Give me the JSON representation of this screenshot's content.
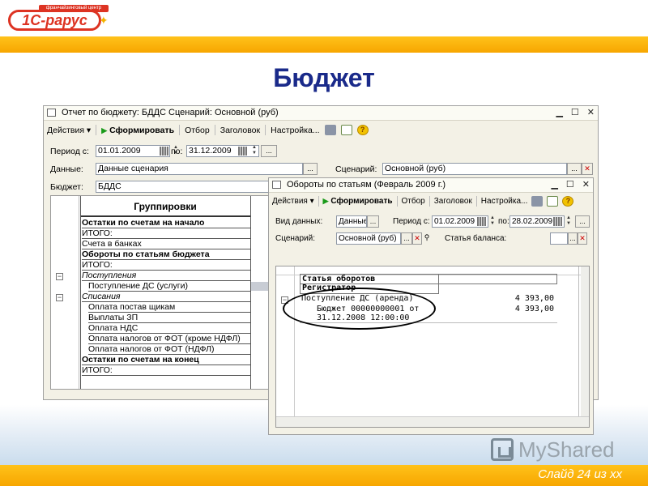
{
  "brand": {
    "logo_text": "1С-рарус",
    "logo_ribbon": "франчайзинговый центр"
  },
  "slide": {
    "title": "Бюджет",
    "number": "Слайд 24 из xx"
  },
  "watermark": "MyShared",
  "window1": {
    "title": "Отчет по бюджету: БДДС Сценарий: Основной (руб)",
    "toolbar": {
      "actions": "Действия",
      "generate": "Сформировать",
      "filter": "Отбор",
      "header": "Заголовок",
      "settings": "Настройка..."
    },
    "period_from_label": "Период с:",
    "period_from": "01.01.2009",
    "period_to_label": "по:",
    "period_to": "31.12.2009",
    "data_label": "Данные:",
    "data_value": "Данные сценария",
    "scenario_label": "Сценарий:",
    "scenario_value": "Основной (руб)",
    "budget_label": "Бюджет:",
    "budget_value": "БДДС",
    "grid_header": "Группировки",
    "rows": [
      "Остатки по счетам на начало",
      "ИТОГО:",
      "Счета в банках",
      "Обороты по статьям бюджета",
      "ИТОГО:",
      "Поступления",
      "Поступление ДС (услуги)",
      "Списания",
      "Оплата постав щикам",
      "Выплаты ЗП",
      "Оплата НДС",
      "Оплата налогов от ФОТ (кроме НДФЛ)",
      "Оплата налогов от ФОТ (НДФЛ)",
      "Остатки по счетам на конец",
      "ИТОГО:"
    ]
  },
  "window2": {
    "title": "Обороты по статьям (Февраль 2009 г.)",
    "toolbar": {
      "actions": "Действия",
      "generate": "Сформировать",
      "filter": "Отбор",
      "header": "Заголовок",
      "settings": "Настройка..."
    },
    "view_label": "Вид данных:",
    "view_value": "Данные",
    "period_from_label": "Период с:",
    "period_from": "01.02.2009",
    "period_to_label": "по:",
    "period_to": "28.02.2009",
    "scenario_label": "Сценарий:",
    "scenario_value": "Основной (руб)",
    "article_label": "Статья баланса:",
    "article_value": "",
    "report": {
      "header1": "Статья оборотов",
      "header2": "Регистратор",
      "row1_label": "Поступление ДС (аренда)",
      "row1_value": "4 393,00",
      "row2_label_line1": "Бюджет 00000000001 от",
      "row2_label_line2": "31.12.2008 12:00:00",
      "row2_value": "4 393,00"
    }
  },
  "colors": {
    "band": "#f7a600",
    "title": "#1a2a8a",
    "logo": "#dd3322"
  }
}
